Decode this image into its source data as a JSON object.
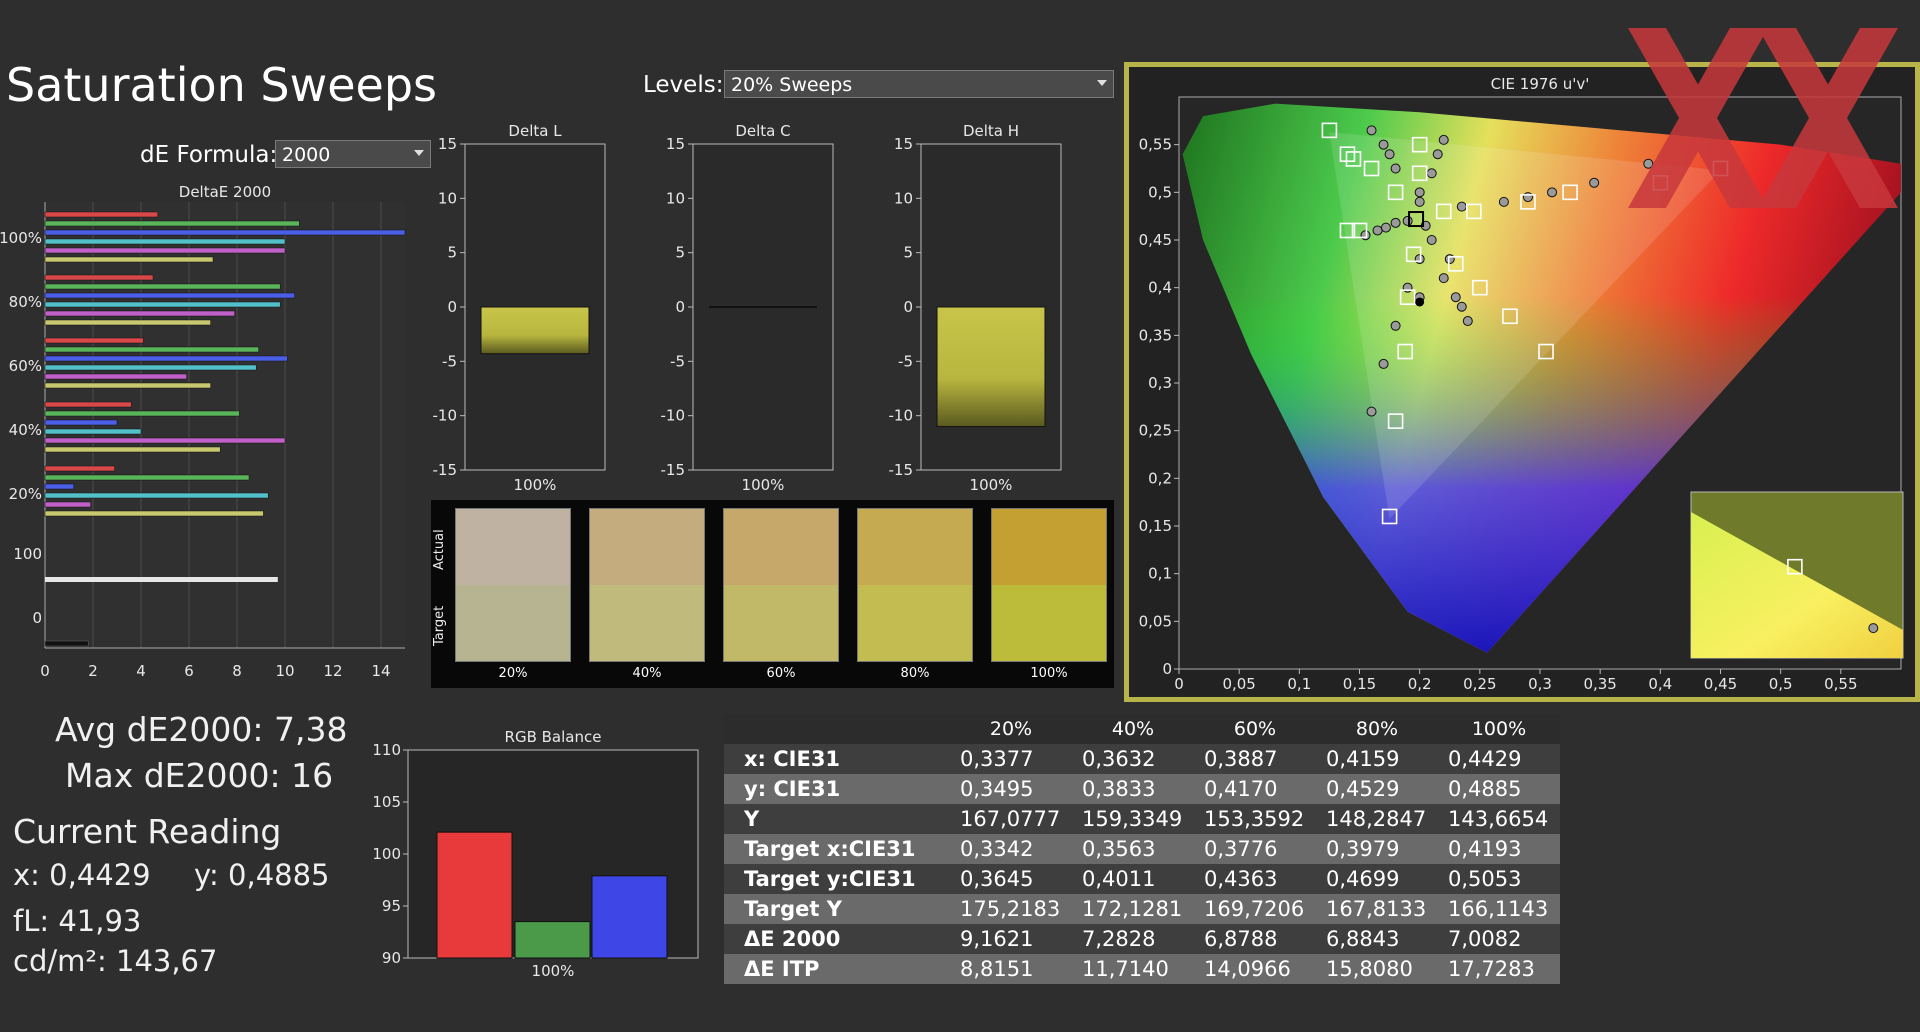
{
  "header": {
    "title": "Saturation Sweeps",
    "levels_label": "Levels:",
    "levels_value": "20% Sweeps",
    "de_formula_label": "dE Formula:",
    "de_formula_value": "2000"
  },
  "deltae_chart": {
    "title": "DeltaE 2000",
    "group_labels": [
      "100%",
      "80%",
      "60%",
      "40%",
      "20%",
      "100",
      "0"
    ],
    "x_ticks": [
      "0",
      "2",
      "4",
      "6",
      "8",
      "10",
      "12",
      "14"
    ],
    "xlim": [
      0,
      15
    ],
    "groups": [
      [
        4.7,
        10.6,
        15.0,
        10.0,
        10.0,
        7.0
      ],
      [
        4.5,
        9.8,
        10.4,
        9.8,
        7.9,
        6.9
      ],
      [
        4.1,
        8.9,
        10.1,
        8.8,
        5.9,
        6.9
      ],
      [
        3.6,
        8.1,
        3.0,
        4.0,
        10.0,
        7.3
      ],
      [
        2.9,
        8.5,
        1.2,
        9.3,
        1.9,
        9.1
      ]
    ],
    "gray_bars": [
      9.7
    ],
    "black_bars": [
      1.8
    ]
  },
  "delta_charts": [
    {
      "title": "Delta L",
      "yticks": [
        "15",
        "10",
        "5",
        "0",
        "-5",
        "-10",
        "-15"
      ],
      "value": -4.3,
      "xlabel": "100%"
    },
    {
      "title": "Delta C",
      "yticks": [
        "15",
        "10",
        "5",
        "0",
        "-5",
        "-10",
        "-15"
      ],
      "value": -0.1,
      "xlabel": "100%"
    },
    {
      "title": "Delta H",
      "yticks": [
        "15",
        "10",
        "5",
        "0",
        "-5",
        "-10",
        "-15"
      ],
      "value": -11.0,
      "xlabel": "100%"
    }
  ],
  "swatches": {
    "actual_label": "Actual",
    "target_label": "Target",
    "items": [
      {
        "label": "20%",
        "actual": "#bfb2a2",
        "target": "#b7b492"
      },
      {
        "label": "40%",
        "actual": "#c5ac7e",
        "target": "#c0bb7c"
      },
      {
        "label": "60%",
        "actual": "#c6a96a",
        "target": "#c1b967"
      },
      {
        "label": "80%",
        "actual": "#c6aa52",
        "target": "#c2bc51"
      },
      {
        "label": "100%",
        "actual": "#c4a032",
        "target": "#bcbb3a"
      }
    ]
  },
  "stats": {
    "avg": "Avg dE2000: 7,38",
    "max": "Max dE2000: 16",
    "current_reading": "Current Reading",
    "x": "x: 0,4429",
    "y": "y: 0,4885",
    "fl": "fL: 41,93",
    "cdm2": "cd/m²: 143,67"
  },
  "rgb_balance": {
    "title": "RGB Balance",
    "yticks": [
      "110",
      "105",
      "100",
      "95",
      "90"
    ],
    "ylim": [
      90,
      110
    ],
    "values": [
      102.1,
      93.5,
      97.9
    ],
    "colors": [
      "#e83a3a",
      "#4a9a4a",
      "#3e46e6"
    ],
    "xlabel": "100%"
  },
  "table": {
    "headers": [
      "20%",
      "40%",
      "60%",
      "80%",
      "100%"
    ],
    "rows": [
      {
        "label": "x: CIE31",
        "values": [
          "0,3377",
          "0,3632",
          "0,3887",
          "0,4159",
          "0,4429"
        ]
      },
      {
        "label": "y: CIE31",
        "values": [
          "0,3495",
          "0,3833",
          "0,4170",
          "0,4529",
          "0,4885"
        ]
      },
      {
        "label": "Y",
        "values": [
          "167,0777",
          "159,3349",
          "153,3592",
          "148,2847",
          "143,6654"
        ]
      },
      {
        "label": "Target x:CIE31",
        "values": [
          "0,3342",
          "0,3563",
          "0,3776",
          "0,3979",
          "0,4193"
        ]
      },
      {
        "label": "Target y:CIE31",
        "values": [
          "0,3645",
          "0,4011",
          "0,4363",
          "0,4699",
          "0,5053"
        ]
      },
      {
        "label": "Target Y",
        "values": [
          "175,2183",
          "172,1281",
          "169,7206",
          "167,8133",
          "166,1143"
        ]
      },
      {
        "label": "ΔE 2000",
        "values": [
          "9,1621",
          "7,2828",
          "6,8788",
          "6,8843",
          "7,0082"
        ]
      },
      {
        "label": "ΔE ITP",
        "values": [
          "8,8151",
          "11,7140",
          "14,0966",
          "15,8080",
          "17,7283"
        ]
      }
    ]
  },
  "cie_chart": {
    "title": "CIE 1976 u'v'",
    "x_ticks": [
      "0",
      "0,05",
      "0,1",
      "0,15",
      "0,2",
      "0,25",
      "0,3",
      "0,35",
      "0,4",
      "0,45",
      "0,5",
      "0,55"
    ],
    "y_ticks": [
      "0",
      "0,05",
      "0,1",
      "0,15",
      "0,2",
      "0,25",
      "0,3",
      "0,35",
      "0,4",
      "0,45",
      "0,5",
      "0,55"
    ],
    "xlim": [
      0,
      0.6
    ],
    "ylim": [
      0,
      0.6
    ],
    "targets": [
      [
        0.125,
        0.565
      ],
      [
        0.14,
        0.54
      ],
      [
        0.145,
        0.535
      ],
      [
        0.16,
        0.525
      ],
      [
        0.18,
        0.5
      ],
      [
        0.2,
        0.55
      ],
      [
        0.2,
        0.52
      ],
      [
        0.22,
        0.48
      ],
      [
        0.245,
        0.48
      ],
      [
        0.29,
        0.49
      ],
      [
        0.325,
        0.5
      ],
      [
        0.14,
        0.46
      ],
      [
        0.15,
        0.46
      ],
      [
        0.197,
        0.472
      ],
      [
        0.195,
        0.435
      ],
      [
        0.23,
        0.425
      ],
      [
        0.25,
        0.4
      ],
      [
        0.275,
        0.37
      ],
      [
        0.305,
        0.333
      ],
      [
        0.19,
        0.39
      ],
      [
        0.188,
        0.333
      ],
      [
        0.18,
        0.26
      ],
      [
        0.175,
        0.16
      ],
      [
        0.4,
        0.51
      ],
      [
        0.45,
        0.525
      ]
    ],
    "measured": [
      [
        0.16,
        0.565
      ],
      [
        0.17,
        0.55
      ],
      [
        0.175,
        0.54
      ],
      [
        0.18,
        0.525
      ],
      [
        0.2,
        0.49
      ],
      [
        0.215,
        0.54
      ],
      [
        0.22,
        0.555
      ],
      [
        0.21,
        0.52
      ],
      [
        0.2,
        0.5
      ],
      [
        0.235,
        0.485
      ],
      [
        0.27,
        0.49
      ],
      [
        0.29,
        0.495
      ],
      [
        0.31,
        0.5
      ],
      [
        0.345,
        0.51
      ],
      [
        0.155,
        0.455
      ],
      [
        0.165,
        0.46
      ],
      [
        0.172,
        0.463
      ],
      [
        0.18,
        0.468
      ],
      [
        0.19,
        0.47
      ],
      [
        0.205,
        0.465
      ],
      [
        0.21,
        0.45
      ],
      [
        0.2,
        0.43
      ],
      [
        0.225,
        0.43
      ],
      [
        0.22,
        0.41
      ],
      [
        0.23,
        0.39
      ],
      [
        0.235,
        0.38
      ],
      [
        0.24,
        0.365
      ],
      [
        0.19,
        0.4
      ],
      [
        0.2,
        0.39
      ],
      [
        0.18,
        0.36
      ],
      [
        0.17,
        0.32
      ],
      [
        0.16,
        0.27
      ],
      [
        0.39,
        0.53
      ]
    ],
    "current": [
      0.2,
      0.385
    ],
    "white_target": [
      0.197,
      0.472
    ],
    "inset_target": [
      0.49,
      0.45
    ],
    "inset_measured": [
      0.56,
      0.37
    ]
  }
}
